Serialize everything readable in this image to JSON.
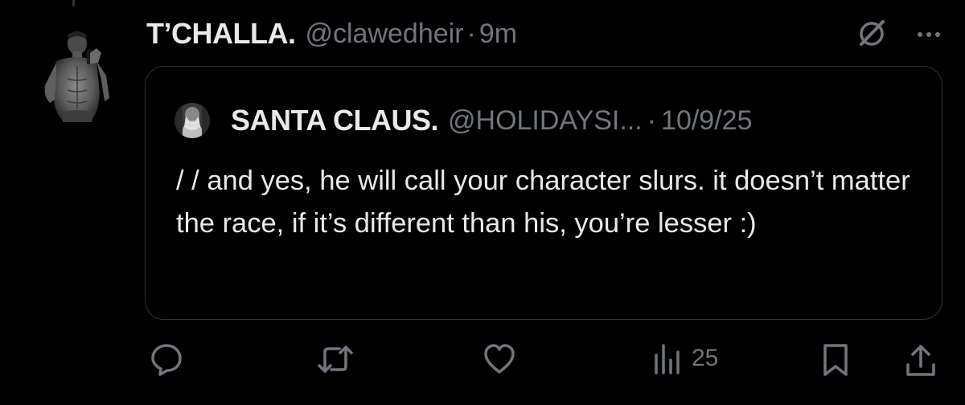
{
  "post": {
    "display_name": "T’CHALLA.",
    "handle": "@clawedheir",
    "separator": "·",
    "time": "9m",
    "avatar_icon": "avatar-photo",
    "grok_icon": "grok-slash-icon",
    "more_icon": "more-dots-icon"
  },
  "quote": {
    "display_name": "SANTA CLAUS.",
    "handle": "@HOLIDAYSI...",
    "separator": "·",
    "date": "10/9/25",
    "text": "/ / and yes, he will call your character slurs. it doesn’t matter the race, if it’s different than his, you’re lesser :)"
  },
  "actions": {
    "reply_icon": "reply-icon",
    "repost_icon": "repost-icon",
    "like_icon": "heart-icon",
    "views_icon": "views-icon",
    "views_count": "25",
    "bookmark_icon": "bookmark-icon",
    "share_icon": "share-icon"
  },
  "colors": {
    "background": "#000000",
    "primary_text": "#e7e9ea",
    "secondary_text": "#71767b",
    "border": "#2f3336"
  }
}
